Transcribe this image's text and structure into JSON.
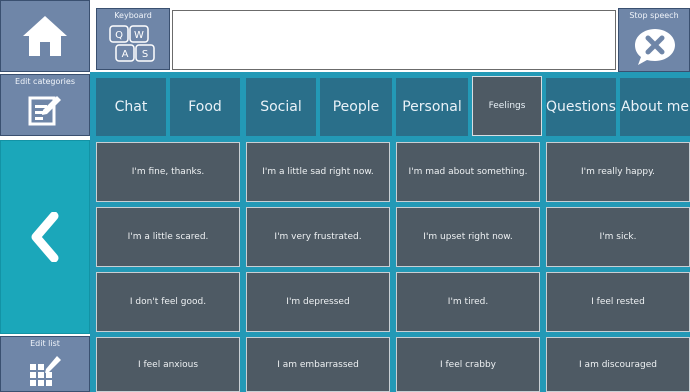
{
  "left_panel": {
    "edit_categories_label": "Edit categories",
    "edit_list_label": "Edit list"
  },
  "top_bar": {
    "keyboard_label": "Keyboard",
    "keyboard_keys": [
      "Q",
      "W",
      "A",
      "S"
    ],
    "stop_speech_label": "Stop speech",
    "speech_text": ""
  },
  "tabs": [
    {
      "label": "Chat"
    },
    {
      "label": "Food"
    },
    {
      "label": "Social"
    },
    {
      "label": "People"
    },
    {
      "label": "Personal"
    },
    {
      "label": "Feelings",
      "active": true
    },
    {
      "label": "Questions"
    },
    {
      "label": "About me"
    }
  ],
  "phrases": [
    [
      "I'm fine,  thanks.",
      "I'm a little sad right now.",
      "I'm mad about something.",
      "I'm really happy."
    ],
    [
      "I'm a little scared.",
      "I'm very frustrated.",
      "I'm upset right now.",
      "I'm sick."
    ],
    [
      "I don't feel good.",
      "I'm depressed",
      "I'm tired.",
      "I feel rested"
    ],
    [
      "I feel anxious",
      "I am embarrassed",
      "I feel crabby",
      "I am discouraged"
    ]
  ],
  "colors": {
    "accent": "#2399b6",
    "button": "#6f86a8",
    "cell": "#4e5a64",
    "back": "#1ba7ba"
  },
  "icons": {
    "home": "home-icon",
    "keyboard": "keyboard-icon",
    "stop": "stop-speech-icon",
    "edit_categories": "edit-categories-icon",
    "back": "chevron-left-icon",
    "edit_list": "edit-list-icon"
  }
}
